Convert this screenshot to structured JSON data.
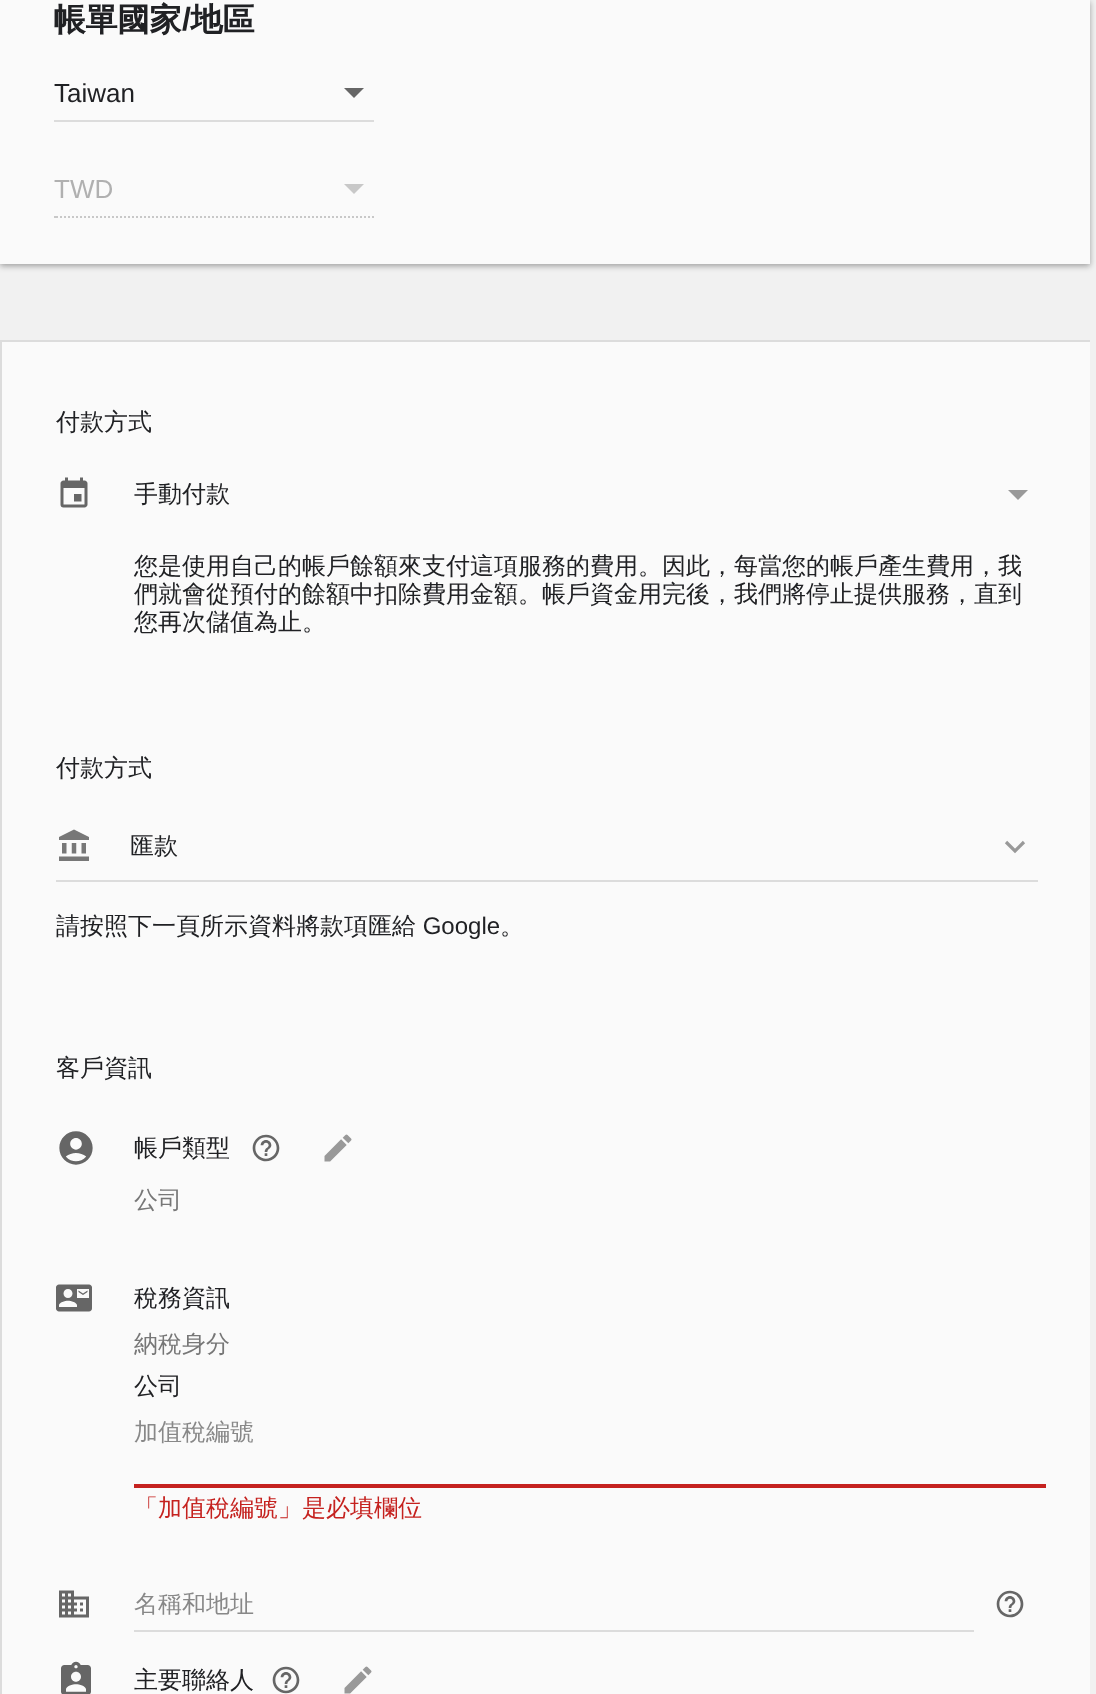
{
  "billing": {
    "title": "帳單國家/地區",
    "country": {
      "value": "Taiwan",
      "disabled": false
    },
    "currency": {
      "value": "TWD",
      "disabled": true
    }
  },
  "payment_schedule": {
    "label": "付款方式",
    "value": "手動付款",
    "description": "您是使用自己的帳戶餘額來支付這項服務的費用。因此，每當您的帳戶產生費用，我們就會從預付的餘額中扣除費用金額。帳戶資金用完後，我們將停止提供服務，直到您再次儲值為止。"
  },
  "payment_method": {
    "label": "付款方式",
    "value": "匯款",
    "note": "請按照下一頁所示資料將款項匯給 Google。"
  },
  "customer_info": {
    "title": "客戶資訊",
    "account_type": {
      "label": "帳戶類型",
      "value": "公司"
    },
    "tax_info": {
      "label": "稅務資訊",
      "status_label": "納稅身分",
      "status_value": "公司",
      "vat": {
        "placeholder": "加值稅編號",
        "error": "「加值稅編號」是必填欄位"
      }
    },
    "name_address": {
      "placeholder": "名稱和地址"
    },
    "primary_contact": {
      "label": "主要聯絡人"
    }
  }
}
